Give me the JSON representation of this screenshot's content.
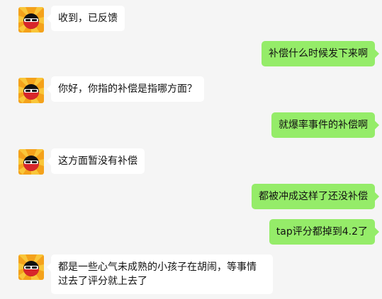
{
  "messages": [
    {
      "side": "in",
      "text": "收到，已反馈"
    },
    {
      "side": "out",
      "text": "补偿什么时候发下来啊"
    },
    {
      "side": "in",
      "text": "你好，你指的补偿是指哪方面？"
    },
    {
      "side": "out",
      "text": "就爆率事件的补偿啊"
    },
    {
      "side": "in",
      "text": "这方面暂没有补偿"
    },
    {
      "side": "out",
      "text": "都被冲成这样了还没补偿"
    },
    {
      "side": "out",
      "text": "tap评分都掉到4.2了"
    },
    {
      "side": "in",
      "text": "都是一些心气未成熟的小孩子在胡闹，等事情过去了评分就上去了"
    }
  ],
  "colors": {
    "background": "#f5f5f5",
    "incoming_bubble": "#ffffff",
    "outgoing_bubble": "#95ec69",
    "avatar_bg": "#f4a21b"
  },
  "icons": {
    "agent_avatar": "ninja-avatar-icon"
  }
}
